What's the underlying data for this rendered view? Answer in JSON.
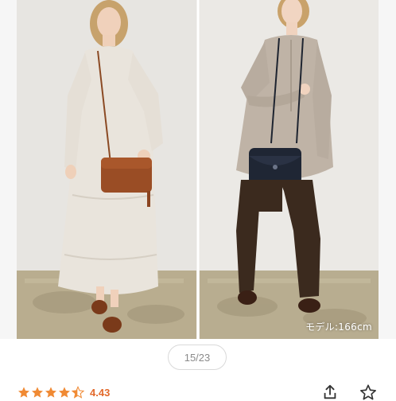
{
  "photo": {
    "caption": "モデル:166cm",
    "description_icon": "product-photo"
  },
  "pagination": {
    "counter": "15/23"
  },
  "rating": {
    "value": "4.43",
    "stars": 4.43,
    "star_color": "#f08a34"
  },
  "actions": {
    "share_icon": "share-icon",
    "favorite_icon": "star-outline-icon"
  },
  "colors": {
    "accent": "#e26a2c",
    "counter_border": "#d9d9d9"
  }
}
